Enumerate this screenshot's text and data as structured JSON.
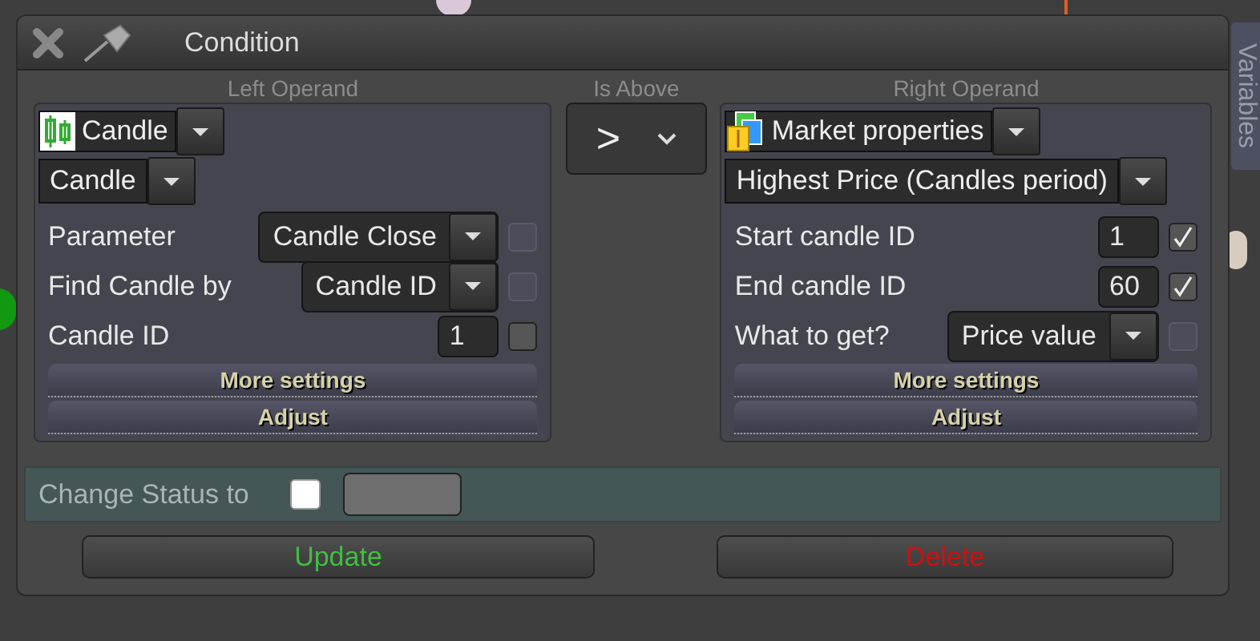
{
  "window": {
    "title": "Condition"
  },
  "side_tab": {
    "label": "Variables"
  },
  "left_operand": {
    "heading": "Left Operand",
    "source": {
      "label": "Candle"
    },
    "type": {
      "label": "Candle"
    },
    "rows": [
      {
        "kind": "select",
        "label": "Parameter",
        "value": "Candle Close",
        "checked": false,
        "disabled": true
      },
      {
        "kind": "select",
        "label": "Find Candle by",
        "value": "Candle ID",
        "checked": false,
        "disabled": true
      },
      {
        "kind": "number",
        "label": "Candle ID",
        "value": "1",
        "checked": false,
        "disabled": false
      }
    ],
    "buttons": [
      "More settings",
      "Adjust"
    ]
  },
  "operator": {
    "heading": "Is Above",
    "value": ">"
  },
  "right_operand": {
    "heading": "Right Operand",
    "source": {
      "label": "Market properties"
    },
    "type": {
      "label": "Highest Price (Candles period)"
    },
    "rows": [
      {
        "kind": "number",
        "label": "Start candle ID",
        "value": "1",
        "checked": true,
        "disabled": false
      },
      {
        "kind": "number",
        "label": "End candle ID",
        "value": "60",
        "checked": true,
        "disabled": false
      },
      {
        "kind": "select",
        "label": "What to get?",
        "value": "Price value",
        "checked": false,
        "disabled": true
      }
    ],
    "buttons": [
      "More settings",
      "Adjust"
    ]
  },
  "status": {
    "label": "Change Status to",
    "checked": false
  },
  "actions": [
    {
      "label": "Update",
      "kind": "update"
    },
    {
      "label": "Delete",
      "kind": "delete"
    }
  ]
}
